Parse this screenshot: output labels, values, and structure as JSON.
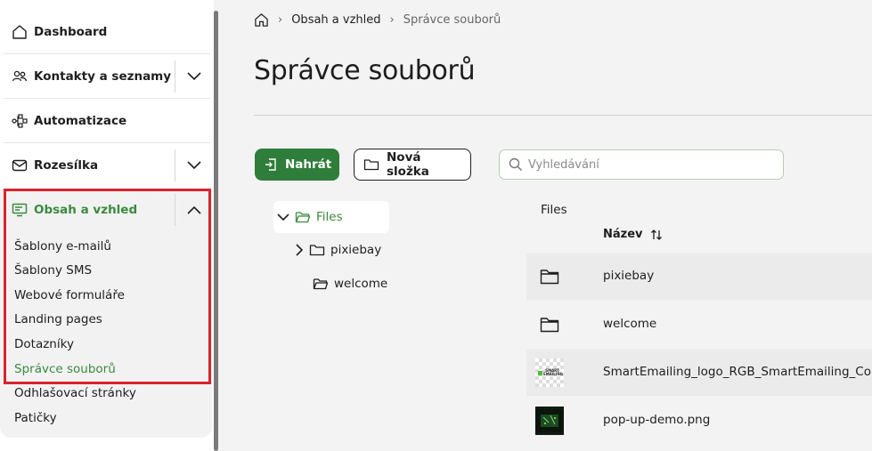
{
  "sidebar": {
    "items": [
      {
        "label": "Dashboard",
        "icon": "home-icon"
      },
      {
        "label": "Kontakty a seznamy",
        "icon": "users-icon"
      },
      {
        "label": "Automatizace",
        "icon": "flow-icon"
      },
      {
        "label": "Rozesílka",
        "icon": "mail-icon"
      },
      {
        "label": "Obsah a vzhled",
        "icon": "monitor-icon"
      }
    ],
    "submenu": [
      "Šablony e-mailů",
      "Šablony SMS",
      "Webové formuláře",
      "Landing pages",
      "Dotazníky",
      "Správce souborů",
      "Odhlašovací stránky",
      "Patičky"
    ],
    "active_submenu": "Správce souborů"
  },
  "breadcrumb": [
    "Obsah a vzhled",
    "Správce souborů"
  ],
  "page_title": "Správce souborů",
  "toolbar": {
    "upload_label": "Nahrát",
    "new_folder_label": "Nová složka"
  },
  "search": {
    "placeholder": "Vyhledávání",
    "value": ""
  },
  "tree": {
    "root": "Files",
    "children": [
      "pixiebay",
      "welcome"
    ]
  },
  "files": {
    "heading": "Files",
    "column_name": "Název",
    "rows": [
      {
        "name": "pixiebay",
        "type": "folder"
      },
      {
        "name": "welcome",
        "type": "folder"
      },
      {
        "name": "SmartEmailing_logo_RGB_SmartEmailing_Co",
        "type": "image",
        "thumb_text": "SMART EMAILING"
      },
      {
        "name": "pop-up-demo.png",
        "type": "image"
      }
    ]
  },
  "colors": {
    "accent": "#2f7d3b",
    "active_text": "#3b8a3e",
    "highlight": "#d9232e"
  }
}
